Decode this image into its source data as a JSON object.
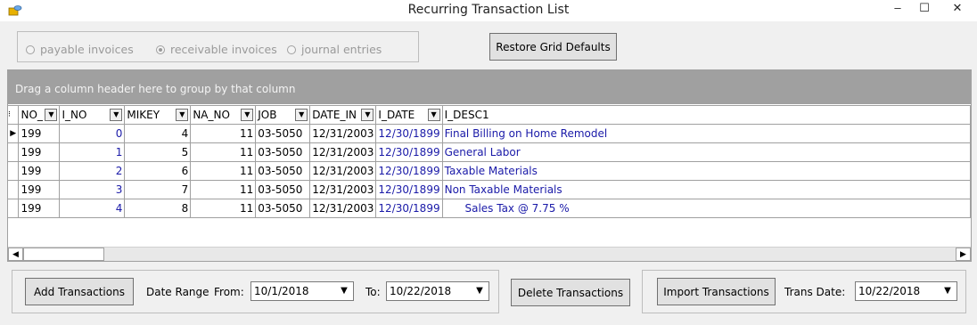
{
  "window": {
    "title": "Recurring Transaction List",
    "min": "–",
    "max": "☐",
    "close": "✕"
  },
  "options": {
    "items": [
      {
        "label": "payable invoices",
        "checked": false
      },
      {
        "label": "receivable invoices",
        "checked": true
      },
      {
        "label": "journal entries",
        "checked": false
      }
    ]
  },
  "toolbar": {
    "restore_label": "Restore Grid Defaults"
  },
  "grid": {
    "group_hint": "Drag a column header here to group by that column",
    "columns": [
      "NO_",
      "I_NO",
      "MIKEY",
      "NA_NO",
      "JOB",
      "DATE_IN",
      "I_DATE",
      "I_DESC1"
    ],
    "rows": [
      [
        "199",
        "0",
        "4",
        "11",
        "03-5050",
        "12/31/2003",
        "12/30/1899",
        "Final Billing on Home Remodel"
      ],
      [
        "199",
        "1",
        "5",
        "11",
        "03-5050",
        "12/31/2003",
        "12/30/1899",
        "General Labor"
      ],
      [
        "199",
        "2",
        "6",
        "11",
        "03-5050",
        "12/31/2003",
        "12/30/1899",
        "Taxable Materials"
      ],
      [
        "199",
        "3",
        "7",
        "11",
        "03-5050",
        "12/31/2003",
        "12/30/1899",
        "Non Taxable Materials"
      ],
      [
        "199",
        "4",
        "8",
        "11",
        "03-5050",
        "12/31/2003",
        "12/30/1899",
        "      Sales Tax @ 7.75 %"
      ]
    ]
  },
  "footer": {
    "add_label": "Add Transactions",
    "date_range_label": "Date Range",
    "from_label": "From:",
    "from_value": "10/1/2018",
    "to_label": "To:",
    "to_value": "10/22/2018",
    "delete_label": "Delete Transactions",
    "import_label": "Import Transactions",
    "trans_date_label": "Trans Date:",
    "trans_date_value": "10/22/2018"
  },
  "colors": {
    "link_blue": "#1a1aa8",
    "group_panel": "#a0a0a0"
  }
}
